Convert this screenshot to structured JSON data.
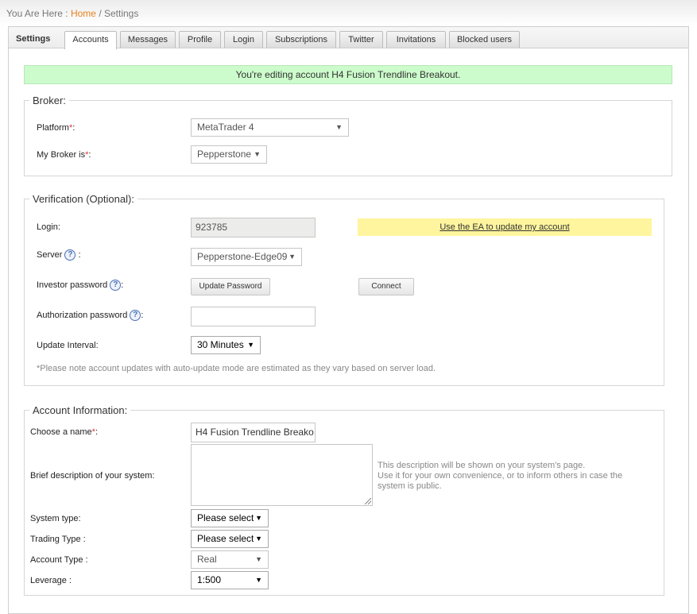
{
  "breadcrumb": {
    "prefix": "You Are Here :",
    "home": "Home",
    "separator": "/",
    "current": "Settings"
  },
  "tabs": {
    "section_label": "Settings",
    "items": [
      "Accounts",
      "Messages",
      "Profile",
      "Login",
      "Subscriptions",
      "Twitter",
      "Invitations",
      "Blocked users"
    ],
    "active": "Accounts"
  },
  "notice": "You're editing account H4 Fusion Trendline Breakout.",
  "broker": {
    "legend": "Broker:",
    "platform_label": "Platform",
    "platform_value": "MetaTrader 4",
    "mybroker_label": "My Broker is",
    "mybroker_value": "Pepperstone",
    "required_mark": "*",
    "colon": ":"
  },
  "verification": {
    "legend": "Verification (Optional):",
    "login_label": "Login:",
    "login_value": "923785",
    "ea_link": "Use the EA to update my account",
    "server_label": "Server",
    "server_value": "Pepperstone-Edge09",
    "investor_label": "Investor password",
    "update_password_button": "Update Password",
    "connect_button": "Connect",
    "auth_label": "Authorization password",
    "auth_value": "",
    "interval_label": "Update Interval:",
    "interval_value": "30 Minutes",
    "note": "*Please note account updates with auto-update mode are estimated as they vary based on server load.",
    "colon": ":"
  },
  "account_info": {
    "legend": "Account Information:",
    "name_label": "Choose a name",
    "name_value": "H4 Fusion Trendline Breako",
    "description_label": "Brief description of your system:",
    "description_value": "",
    "hint_lines": [
      "This description will be shown on your system's page.",
      "Use it for your own convenience, or to inform others in case the",
      "system is public."
    ],
    "system_type_label": "System type:",
    "system_type_value": "Please select",
    "trading_type_label": "Trading Type :",
    "trading_type_value": "Please select",
    "account_type_label": "Account Type :",
    "account_type_value": "Real",
    "leverage_label": "Leverage :",
    "leverage_value": "1:500",
    "required_mark": "*",
    "colon": ":"
  },
  "icons": {
    "help": "?",
    "dropdown": "▼"
  }
}
